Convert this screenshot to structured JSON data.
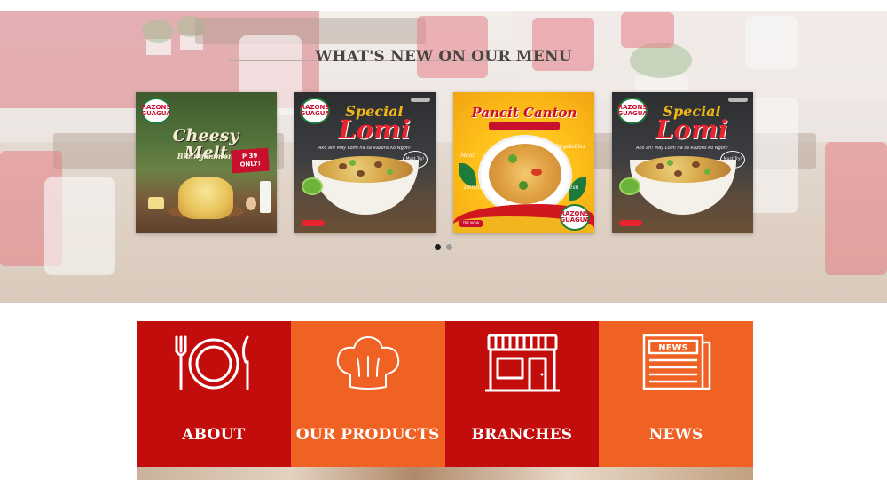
{
  "menu": {
    "heading": "WHAT'S NEW ON OUR MENU",
    "cards": [
      {
        "name": "Cheesy Melt",
        "brand_logo": "RAZONS GUAGUA",
        "title": "Cheesy Melt",
        "subtitle": "Bibingmamon!",
        "price": "P 39 ONLY!"
      },
      {
        "name": "Special Lomi",
        "brand_logo": "RAZONS GUAGUA",
        "title_line1": "Special",
        "title_line2": "Lomi",
        "tagline": "Ako ah! May Lomi na sa Razons Ko Ngon!",
        "badge": "Must Try!"
      },
      {
        "name": "Pancit Canton",
        "brand_logo": "RAZONS GUAGUA",
        "title": "Pancit Canton",
        "labels": [
          "Meat",
          "Vegetables",
          "Delicious",
          "Fresh"
        ],
        "cta": "TRY NOW"
      },
      {
        "name": "Special Lomi",
        "brand_logo": "RAZONS GUAGUA",
        "title_line1": "Special",
        "title_line2": "Lomi",
        "tagline": "Ako ah! May Lomi na sa Razons Ko Ngon!",
        "badge": "Must Try!"
      }
    ],
    "carousel": {
      "pages": 2,
      "active": 1
    }
  },
  "tiles": [
    {
      "label": "ABOUT",
      "icon": "plate-cutlery-icon",
      "color": "#c30d0d"
    },
    {
      "label": "OUR PRODUCTS",
      "icon": "chef-hat-icon",
      "color": "#f06124"
    },
    {
      "label": "BRANCHES",
      "icon": "storefront-icon",
      "color": "#c30d0d"
    },
    {
      "label": "NEWS",
      "icon": "newspaper-icon",
      "color": "#f06124"
    }
  ]
}
